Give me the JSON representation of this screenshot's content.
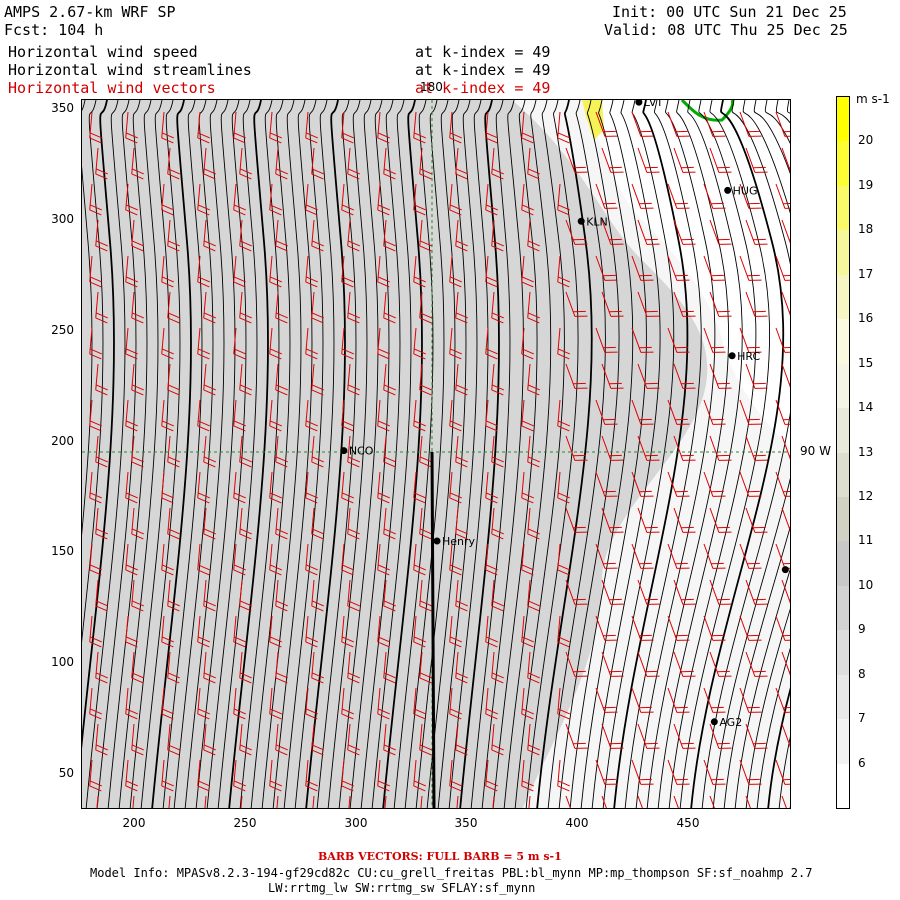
{
  "header": {
    "title": "AMPS 2.67-km WRF SP",
    "forecast": "Fcst: 104 h",
    "init": "Init: 00 UTC Sun 21 Dec 25",
    "valid": "Valid: 08 UTC Thu 25 Dec 25",
    "fields": [
      {
        "name": "Horizontal wind speed",
        "level": "at k-index = 49",
        "color": "#000000"
      },
      {
        "name": "Horizontal wind streamlines",
        "level": "at k-index = 49",
        "color": "#000000"
      },
      {
        "name": "Horizontal wind vectors",
        "level": "at k-index = 49",
        "color": "#d00000"
      }
    ]
  },
  "map": {
    "x_ticks": [
      "200",
      "250",
      "300",
      "350",
      "400",
      "450"
    ],
    "y_ticks": [
      "350",
      "300",
      "250",
      "200",
      "150",
      "100",
      "50"
    ],
    "xlim": [
      175,
      495
    ],
    "ylim": [
      33,
      355
    ],
    "meridian_label": "180",
    "parallel_label": "90 W",
    "stations": [
      {
        "name": "LVT",
        "x": 426,
        "y": 354
      },
      {
        "name": "HUG",
        "x": 466,
        "y": 314
      },
      {
        "name": "KLN",
        "x": 400,
        "y": 300
      },
      {
        "name": "HRC",
        "x": 468,
        "y": 239
      },
      {
        "name": "NCO",
        "x": 293,
        "y": 196
      },
      {
        "name": "Henry",
        "x": 335,
        "y": 155
      },
      {
        "name": "",
        "x": 492,
        "y": 142
      },
      {
        "name": "AG2",
        "x": 460,
        "y": 73
      }
    ],
    "colors": {
      "barb": "#e00000",
      "streamline": "#000000",
      "grid": "#2a8a2a",
      "land_contour": "#00aa00"
    }
  },
  "colorbar": {
    "unit": "m s-1",
    "levels": [
      "20",
      "19",
      "18",
      "17",
      "16",
      "15",
      "14",
      "13",
      "12",
      "11",
      "10",
      "9",
      "8",
      "7",
      "6"
    ],
    "colors": [
      "#ffff00",
      "#fdfd35",
      "#f9f96a",
      "#f6f69a",
      "#f6f6c4",
      "#fafae0",
      "#f5f5e6",
      "#eaeadc",
      "#dedece",
      "#d2d2c4",
      "#c8c8c8",
      "#d2d2d2",
      "#dddddd",
      "#e8e8e8",
      "#f3f3f3",
      "#ffffff"
    ]
  },
  "footer": {
    "barb_note": "BARB VECTORS: FULL BARB = 5 m s-1",
    "model_info": "Model Info: MPASv8.2.3-194-gf29cd82c CU:cu_grell_freitas PBL:bl_mynn MP:mp_thompson SF:sf_noahmp 2.7",
    "model_info2": "LW:rrtmg_lw SW:rrtmg_sw SFLAY:sf_mynn"
  }
}
